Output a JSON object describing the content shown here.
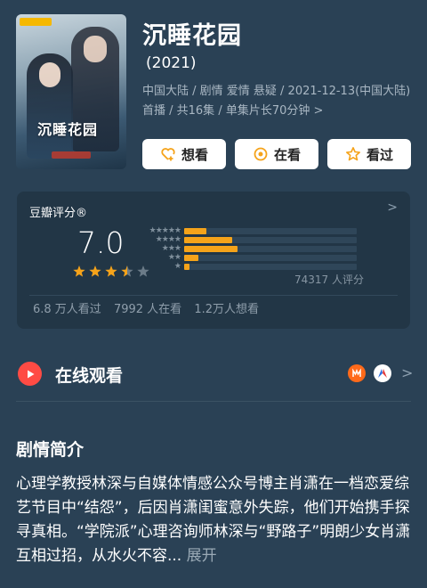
{
  "movie": {
    "title": "沉睡花园",
    "year": "(2021)",
    "meta": "中国大陆 / 剧情 爱情 悬疑 / 2021-12-13(中国大陆) 首播 / 共16集 / 单集片长70分钟",
    "meta_chevron": ">",
    "poster_title": "沉睡花园"
  },
  "actions": [
    {
      "label": "想看",
      "icon": "heart-plus-icon"
    },
    {
      "label": "在看",
      "icon": "circle-dot-icon"
    },
    {
      "label": "看过",
      "icon": "star-outline-icon"
    }
  ],
  "rating": {
    "title": "豆瓣评分®",
    "chevron": ">",
    "score": "7.0",
    "stars_value": 3.5,
    "stars_max": 5,
    "count": "74317 人评分",
    "distribution": [
      {
        "stars": "★★★★★",
        "fraction": 0.13
      },
      {
        "stars": "★★★★",
        "fraction": 0.28
      },
      {
        "stars": "★★★",
        "fraction": 0.31
      },
      {
        "stars": "★★",
        "fraction": 0.08
      },
      {
        "stars": "★",
        "fraction": 0.03
      }
    ],
    "stats": [
      "6.8 万人看过",
      "7992 人在看",
      "1.2万人想看"
    ]
  },
  "online": {
    "label": "在线观看",
    "chevron": ">",
    "platforms": [
      "mango-tv-icon",
      "migu-icon"
    ]
  },
  "synopsis": {
    "title": "剧情简介",
    "text": "心理学教授林深与自媒体情感公众号博主肖潇在一档恋爱综艺节目中“结怨”，后因肖潇闺蜜意外失踪，他们开始携手探寻真相。“学院派”心理咨询师林深与“野路子”明朗少女肖潇互相过招，从水火不容...",
    "more": "展开"
  },
  "colors": {
    "background": "#2a4155",
    "card": "#223646",
    "accent": "#f5a31a",
    "play": "#ff4b44"
  }
}
